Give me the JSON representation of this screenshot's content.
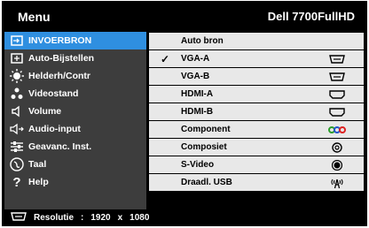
{
  "header": {
    "title": "Menu",
    "model": "Dell 7700FullHD"
  },
  "menu": [
    {
      "label": "INVOERBRON",
      "icon": "input-source-icon",
      "active": true
    },
    {
      "label": "Auto-Bijstellen",
      "icon": "auto-adjust-icon"
    },
    {
      "label": "Helderh/Contr",
      "icon": "brightness-icon"
    },
    {
      "label": "Videostand",
      "icon": "video-mode-icon"
    },
    {
      "label": "Volume",
      "icon": "speaker-icon"
    },
    {
      "label": "Audio-input",
      "icon": "audio-input-icon"
    },
    {
      "label": "Geavanc. Inst.",
      "icon": "advanced-settings-icon"
    },
    {
      "label": "Taal",
      "icon": "language-icon"
    },
    {
      "label": "Help",
      "icon": "help-icon"
    }
  ],
  "sources": [
    {
      "label": "Auto bron",
      "check": "",
      "icon": ""
    },
    {
      "label": "VGA-A",
      "check": "✓",
      "icon": "vga-icon"
    },
    {
      "label": "VGA-B",
      "check": "",
      "icon": "vga-icon"
    },
    {
      "label": "HDMI-A",
      "check": "",
      "icon": "hdmi-icon"
    },
    {
      "label": "HDMI-B",
      "check": "",
      "icon": "hdmi-icon"
    },
    {
      "label": "Component",
      "check": "",
      "icon": "component-icon"
    },
    {
      "label": "Composiet",
      "check": "",
      "icon": "composite-icon"
    },
    {
      "label": "S-Video",
      "check": "",
      "icon": "svideo-icon"
    },
    {
      "label": "Draadl. USB",
      "check": "",
      "icon": "wireless-usb-icon"
    }
  ],
  "footer": {
    "label": "Resolutie",
    "sep": ":",
    "width": "1920",
    "x": "x",
    "height": "1080"
  },
  "colors": {
    "active": "#2f8fe0",
    "panel": "#3d3d3d",
    "row": "#e8e8e8"
  }
}
